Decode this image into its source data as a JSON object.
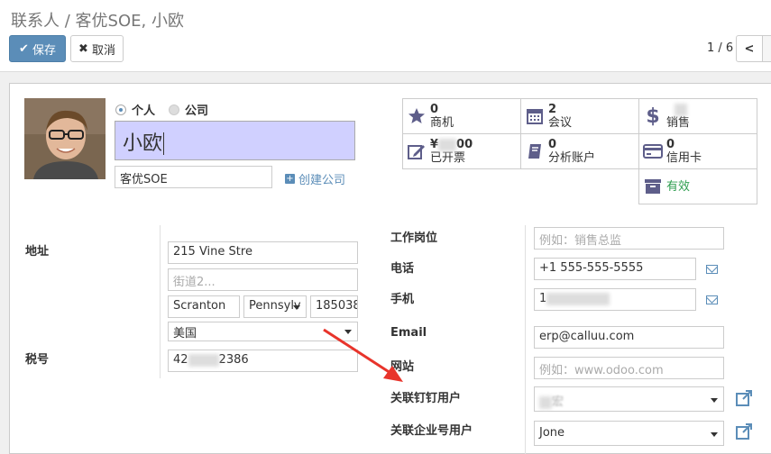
{
  "breadcrumb": {
    "parent": "联系人",
    "separator": "/",
    "current": "客优SOE, 小欧"
  },
  "toolbar": {
    "save_label": "保存",
    "cancel_label": "取消"
  },
  "pager": {
    "value": "1 / 6"
  },
  "contact_type": {
    "options": [
      "个人",
      "公司"
    ],
    "selected": "个人"
  },
  "name": "小欧",
  "company": {
    "value": "客优SOE",
    "create_label": "创建公司"
  },
  "stats": [
    {
      "icon": "star-icon",
      "count": "0",
      "label": "商机"
    },
    {
      "icon": "calendar-icon",
      "count": "2",
      "label": "会议"
    },
    {
      "icon": "dollar-icon",
      "count": "¥",
      "label": "销售"
    },
    {
      "icon": "invoice-edit-icon",
      "count": "¥",
      "count_tail": "00",
      "label": "已开票"
    },
    {
      "icon": "book-icon",
      "count": "0",
      "label": "分析账户"
    },
    {
      "icon": "credit-card-icon",
      "count": "0",
      "label": "信用卡"
    },
    {
      "icon": "archive-icon",
      "count": "",
      "label": "有效"
    }
  ],
  "address": {
    "label": "地址",
    "street": "215 Vine Stre",
    "street2_placeholder": "街道2...",
    "city": "Scranton",
    "state": "Pennsylv",
    "zip": "185038",
    "country": "美国"
  },
  "tax": {
    "label": "税号",
    "value_head": "42",
    "value_tail": "2386"
  },
  "job": {
    "label": "工作岗位",
    "placeholder": "例如：销售总监"
  },
  "phone": {
    "label": "电话",
    "value": "+1 555-555-5555"
  },
  "mobile": {
    "label": "手机",
    "value_head": "1"
  },
  "email": {
    "label": "Email",
    "value": "erp@calluu.com"
  },
  "website": {
    "label": "网站",
    "placeholder": "例如：www.odoo.com"
  },
  "dingtalk": {
    "label": "关联钉钉用户",
    "value_tail": "宏"
  },
  "wechat_work": {
    "label": "关联企业号用户",
    "value": "Jone"
  },
  "colors": {
    "primary": "#5b8db8",
    "name_bg": "#d0d0ff",
    "icon": "#5e5e8a",
    "arrow": "#e8342b"
  }
}
